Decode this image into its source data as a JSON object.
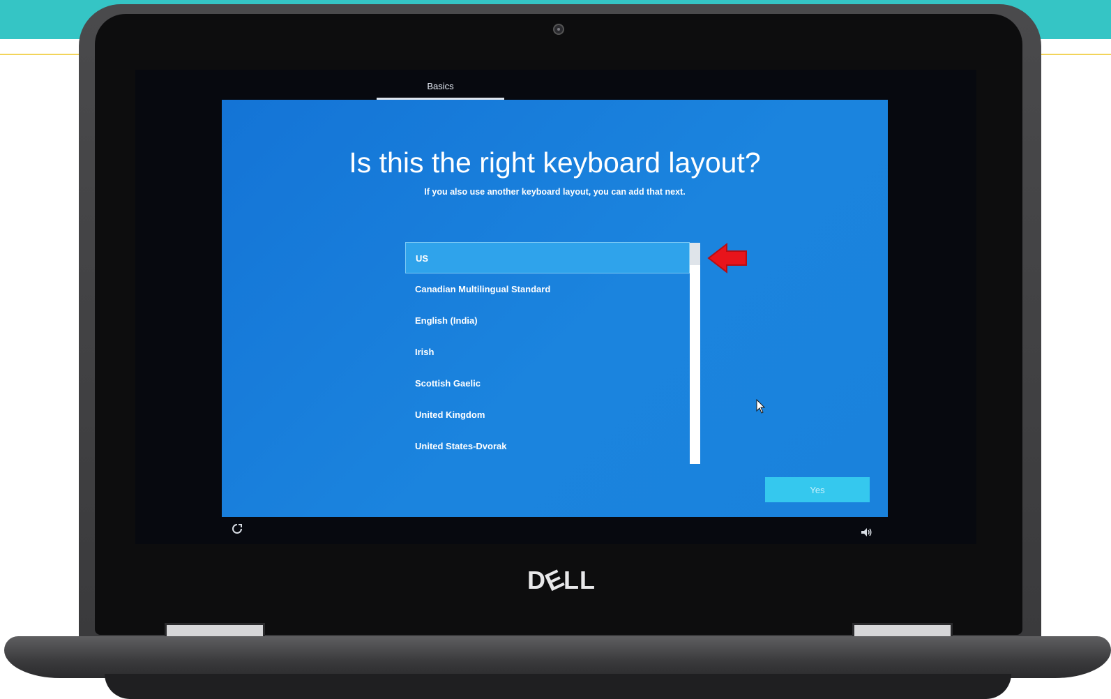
{
  "setup": {
    "tab_label": "Basics",
    "title": "Is this the right keyboard layout?",
    "subtitle": "If you also use another keyboard layout, you can add that next.",
    "keyboard_layouts": [
      {
        "label": "US",
        "selected": true
      },
      {
        "label": "Canadian Multilingual Standard",
        "selected": false
      },
      {
        "label": "English (India)",
        "selected": false
      },
      {
        "label": "Irish",
        "selected": false
      },
      {
        "label": "Scottish Gaelic",
        "selected": false
      },
      {
        "label": "United Kingdom",
        "selected": false
      },
      {
        "label": "United States-Dvorak",
        "selected": false
      }
    ],
    "yes_button_label": "Yes"
  },
  "device": {
    "brand_logo_text": "DELL"
  },
  "icons": {
    "annotation_arrow": "red-arrow-icon",
    "mouse_cursor": "cursor-icon",
    "ease_of_access": "power-icon",
    "volume": "volume-icon",
    "webcam": "webcam-icon"
  },
  "colors": {
    "banner": "#35c5c5",
    "oobe_background": "#1a7fdb",
    "selected_item": "#2fa3eb",
    "yes_button": "#35c8ee",
    "annotation_arrow": "#e8141b"
  }
}
